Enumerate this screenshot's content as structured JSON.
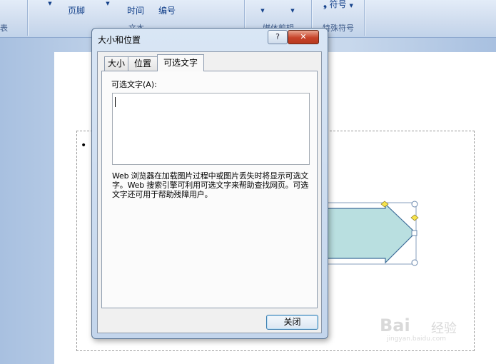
{
  "ribbon": {
    "text_group": {
      "label": "文本",
      "buttons": [
        "页脚",
        "时间",
        "编号"
      ]
    },
    "media_group": {
      "label": "媒体剪辑"
    },
    "symbol_group": {
      "label": "特殊符号",
      "symbol_button": "符号"
    },
    "left_edge_label": "表"
  },
  "dialog": {
    "title": "大小和位置",
    "help_label": "?",
    "close_label": "✕",
    "tabs": [
      {
        "label": "大小",
        "active": false
      },
      {
        "label": "位置",
        "active": false
      },
      {
        "label": "可选文字",
        "active": true
      }
    ],
    "alt_text": {
      "field_label": "可选文字(A):",
      "value": "",
      "description": "Web 浏览器在加载图片过程中或图片丢失时将显示可选文字。Web 搜索引擎可利用可选文字来帮助查找网页。可选文字还可用于帮助残障用户。"
    },
    "close_button": "关闭"
  },
  "document": {
    "bullet": "•"
  },
  "watermark": {
    "brand": "Bai",
    "cn": "经验",
    "url": "jingyan.baidu.com"
  },
  "colors": {
    "arrow_fill": "#b9dfe0",
    "arrow_stroke": "#3f6e9a",
    "handle_yellow": "#f7e44c"
  }
}
